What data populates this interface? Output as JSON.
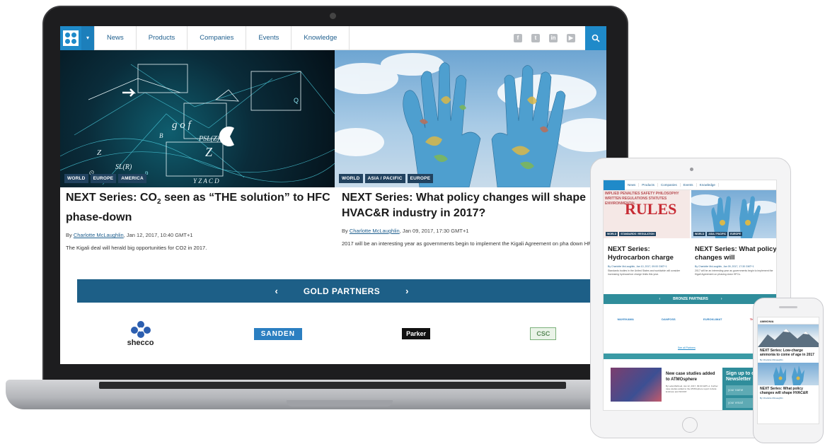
{
  "laptop": {
    "nav": {
      "menu": [
        "News",
        "Products",
        "Companies",
        "Events",
        "Knowledge"
      ],
      "social": [
        "f",
        "t",
        "in",
        "▶"
      ]
    },
    "articles": [
      {
        "tags": [
          "WORLD",
          "EUROPE",
          "AMERICA"
        ],
        "title_pre": "NEXT Series: CO",
        "title_sub": "2",
        "title_post": " seen as “THE solution” to HFC phase-down",
        "by": "By ",
        "author": "Charlotte McLaughlin",
        "date": ", Jan 12, 2017, 10:40 GMT+1",
        "excerpt": "The Kigali deal will herald big opportunities for CO2 in 2017."
      },
      {
        "tags": [
          "WORLD",
          "ASIA / PACIFIC",
          "EUROPE"
        ],
        "title": "NEXT Series: What policy changes will shape HVAC&R industry in 2017?",
        "by": "By ",
        "author": "Charlotte McLaughlin",
        "date": ", Jan 09, 2017, 17:30 GMT+1",
        "excerpt": "2017 will be an interesting year as governments begin to implement the Kigali Agreement on pha down HFCs."
      }
    ],
    "partners": {
      "label": "GOLD PARTNERS",
      "prev": "‹",
      "next": "›",
      "logos": [
        "shecco",
        "SANDEN",
        "Parker",
        "CSC"
      ]
    }
  },
  "tablet": {
    "nav": [
      "News",
      "Products",
      "Companies",
      "Events",
      "Knowledge"
    ],
    "hero_word": "RULES",
    "hero_words": "IMPLIED PENALTIES SAFETY PHILOSOPHY WRITTEN REGULATIONS STATUTES ENVIRONMENTAL",
    "left_tags": [
      "WORLD",
      "STANDARDS / REGULATION"
    ],
    "right_tags": [
      "WORLD",
      "ASIA / PACIFIC",
      "EUROPE"
    ],
    "articles": [
      {
        "title": "NEXT Series: Hydrocarbon charge",
        "meta": "By Charlotte McLaughlin, Jan 10, 2017, 09:00 GMT+1",
        "text": "Standards bodies in the United States and worldwide will consider increasing hydrocarbon charge limits this year."
      },
      {
        "title": "NEXT Series: What policy changes will",
        "meta": "By Charlotte McLaughlin, Jan 09, 2017, 17:30 GMT+1",
        "text": "2017 will be an interesting year as governments begin to implement the Kigali Agreement on phasing down HFCs."
      }
    ],
    "bar_label": "BRONZE PARTNERS",
    "logos": [
      "MAYEKAWA",
      "DANFOSS",
      "EUROKLIMAT",
      "Thermofin"
    ],
    "see_all": "See all Partners",
    "case": {
      "title": "New case studies added to ATMOsphere",
      "meta": "By Leila Mahfoud, Jan 12, 2017, 09:00 GMT+1. Further case studies added to the ATMOsphere report include Embraco and SKOOP."
    },
    "newsletter": {
      "title": "Sign up to our Newsletter",
      "name_placeholder": "your name",
      "email_placeholder": "your email"
    }
  },
  "phone": {
    "brand": "AMMONIA",
    "items": [
      {
        "title": "NEXT Series: Low-charge ammonia to come of age in 2017",
        "meta": "By Charlotte McLaughlin"
      },
      {
        "title": "NEXT Series: What policy changes will shape HVAC&R",
        "meta": "By Charlotte McLaughlin"
      }
    ]
  },
  "colors": {
    "brand_blue": "#1f8ac9",
    "partners_bar": "#1d5f87",
    "tablet_accent": "#2f8d9b",
    "tag_bg": "#21425f"
  }
}
